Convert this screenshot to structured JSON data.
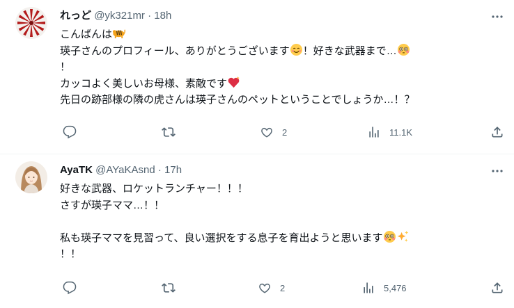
{
  "tweets": [
    {
      "display_name": "れっど",
      "handle_time": "@yk321mr · 18h",
      "lines": [
        {
          "text": "こんばんは",
          "emoji_after": "tiger"
        },
        {
          "text": "瑛子さんのプロフィール、ありがとうございます",
          "emoji_after": "smiling-face",
          "text2": "！好きな武器まで…",
          "emoji_after2": "flushed-face"
        },
        {
          "text": "！"
        },
        {
          "text": "カッコよく美しいお母様、素敵です",
          "emoji_after": "sparkling-heart"
        },
        {
          "text": "先日の跡部様の隣の虎さんは瑛子さんのペットということでしょうか…！？"
        }
      ],
      "replies": "",
      "retweets": "",
      "likes": "2",
      "views": "11.1K"
    },
    {
      "display_name": "AyaTK",
      "handle_time": "@AYaKAsnd · 17h",
      "lines": [
        {
          "text": "好きな武器、ロケットランチャー！！！"
        },
        {
          "text": "さすが瑛子ママ…！！"
        },
        {
          "text": ""
        },
        {
          "text": "私も瑛子ママを見習って、良い選択をする息子を育出ようと思います",
          "emoji_after": "flushed-face",
          "emoji_after_b": "sparkles"
        },
        {
          "text": "！！"
        }
      ],
      "replies": "",
      "retweets": "",
      "likes": "2",
      "views": "5,476"
    }
  ],
  "icons": [
    "more-icon",
    "reply-icon",
    "retweet-icon",
    "like-icon",
    "views-icon",
    "share-icon"
  ]
}
